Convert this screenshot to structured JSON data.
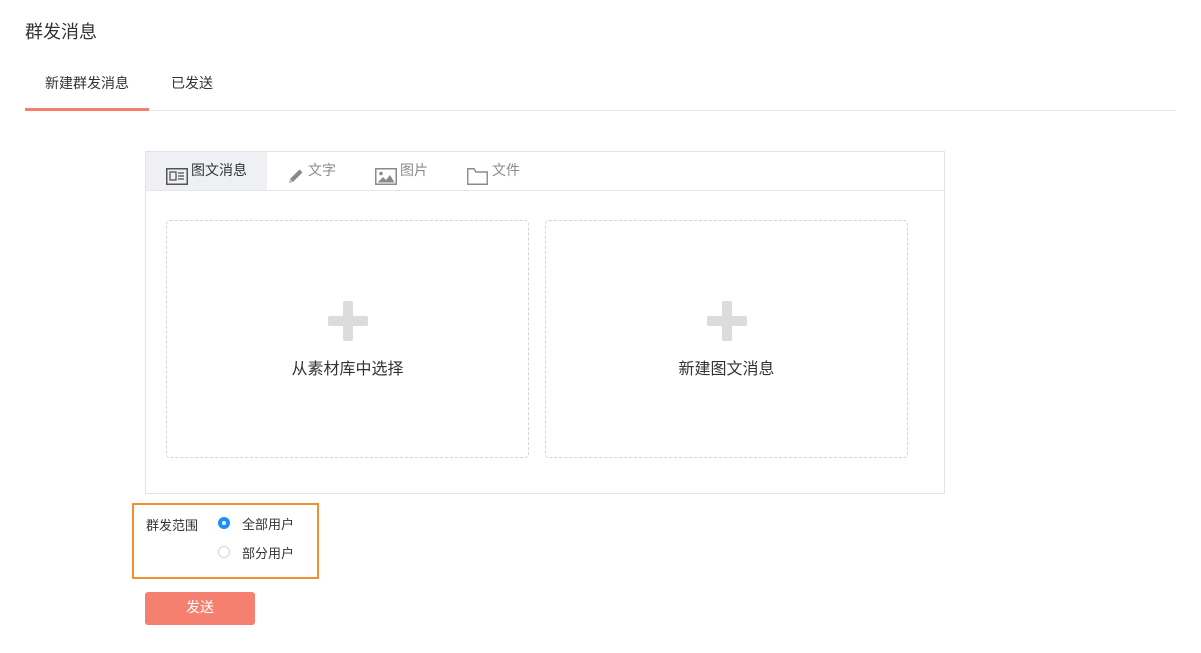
{
  "page": {
    "title": "群发消息"
  },
  "tabs": [
    {
      "label": "新建群发消息",
      "active": true
    },
    {
      "label": "已发送",
      "active": false
    }
  ],
  "editor": {
    "types": [
      {
        "label": "图文消息",
        "icon": "news-icon",
        "active": true
      },
      {
        "label": "文字",
        "icon": "pencil-icon",
        "active": false
      },
      {
        "label": "图片",
        "icon": "image-icon",
        "active": false
      },
      {
        "label": "文件",
        "icon": "folder-icon",
        "active": false
      }
    ],
    "options": [
      {
        "label": "从素材库中选择",
        "icon": "plus-icon"
      },
      {
        "label": "新建图文消息",
        "icon": "plus-icon"
      }
    ]
  },
  "scope": {
    "label": "群发范围",
    "options": [
      {
        "label": "全部用户",
        "checked": true
      },
      {
        "label": "部分用户",
        "checked": false
      }
    ]
  },
  "actions": {
    "send_label": "发送"
  },
  "colors": {
    "accent": "#f5806f",
    "tab_underline": "#f47f6b",
    "highlight_border": "#f0912f",
    "radio_checked": "#1890ff"
  }
}
